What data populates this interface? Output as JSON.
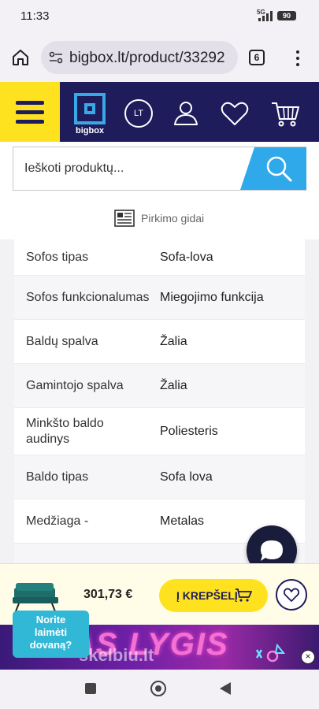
{
  "status": {
    "time": "11:33",
    "network": "5G",
    "battery": "90"
  },
  "browser": {
    "url": "bigbox.lt/product/33292",
    "tab_count": "6"
  },
  "header": {
    "logo_text": "bigbox",
    "language": "LT"
  },
  "search": {
    "placeholder": "Ieškoti produktų..."
  },
  "guides": {
    "label": "Pirkimo gidai"
  },
  "specs": [
    {
      "name": "Sofos tipas",
      "value": "Sofa-lova"
    },
    {
      "name": "Sofos funkcionalumas",
      "value": "Miegojimo funkcija"
    },
    {
      "name": "Baldų spalva",
      "value": "Žalia"
    },
    {
      "name": "Gamintojo spalva",
      "value": "Žalia"
    },
    {
      "name": "Minkšto baldo audinys",
      "value": "Poliesteris"
    },
    {
      "name": "Baldo tipas",
      "value": "Sofa lova"
    },
    {
      "name": "Medžiaga -",
      "value": "Metalas"
    }
  ],
  "cart_bar": {
    "price": "301,73 €",
    "add_to_cart_label": "Į KREPŠELĮ"
  },
  "promo": {
    "line1": "Norite",
    "line2": "laimėti",
    "line3": "dovaną?"
  },
  "ad": {
    "headline": "NAS LYGIS",
    "watermark": "skelbiu.lt",
    "close": "×"
  },
  "colors": {
    "brand_navy": "#1f1c5c",
    "brand_yellow": "#ffe21f",
    "search_blue": "#30a9ea"
  }
}
